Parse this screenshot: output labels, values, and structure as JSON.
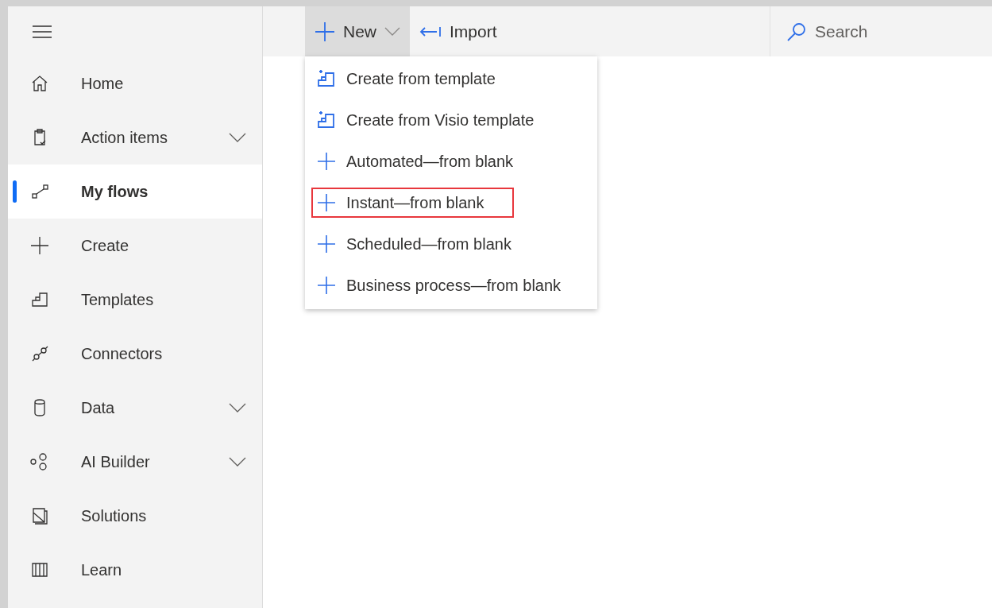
{
  "sidebar": {
    "items": [
      {
        "label": "Home",
        "selected": false
      },
      {
        "label": "Action items",
        "selected": false,
        "expandable": true
      },
      {
        "label": "My flows",
        "selected": true
      },
      {
        "label": "Create",
        "selected": false
      },
      {
        "label": "Templates",
        "selected": false
      },
      {
        "label": "Connectors",
        "selected": false
      },
      {
        "label": "Data",
        "selected": false,
        "expandable": true
      },
      {
        "label": "AI Builder",
        "selected": false,
        "expandable": true
      },
      {
        "label": "Solutions",
        "selected": false
      },
      {
        "label": "Learn",
        "selected": false
      }
    ]
  },
  "toolbar": {
    "new_button": {
      "label": "New",
      "expanded": true
    },
    "import_button": {
      "label": "Import"
    },
    "search": {
      "placeholder": "Search"
    }
  },
  "new_menu": {
    "items": [
      {
        "kind": "template",
        "label": "Create from template",
        "highlighted": false
      },
      {
        "kind": "template",
        "label": "Create from Visio template",
        "highlighted": false
      },
      {
        "kind": "blank",
        "label": "Automated—from blank",
        "highlighted": false
      },
      {
        "kind": "blank",
        "label": "Instant—from blank",
        "highlighted": true
      },
      {
        "kind": "blank",
        "label": "Scheduled—from blank",
        "highlighted": false
      },
      {
        "kind": "blank",
        "label": "Business process—from blank",
        "highlighted": false
      }
    ]
  }
}
